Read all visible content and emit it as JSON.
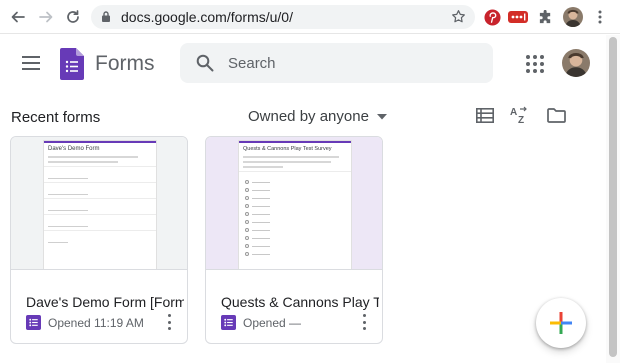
{
  "browser": {
    "url": "docs.google.com/forms/u/0/",
    "icons": [
      "back-arrow-icon",
      "forward-arrow-icon",
      "reload-icon",
      "lock-icon",
      "bookmark-star-icon",
      "pinterest-icon",
      "lastpass-icon",
      "extensions-puzzle-icon",
      "profile-avatar",
      "more-vert-icon"
    ]
  },
  "header": {
    "app_name": "Forms",
    "search_placeholder": "Search",
    "brand_color": "#673ab7"
  },
  "toolbar": {
    "section_title": "Recent forms",
    "owner_filter": "Owned by anyone",
    "view_buttons": [
      "list-view-icon",
      "sort-az-icon",
      "folder-icon"
    ]
  },
  "forms": [
    {
      "name": "Dave's Demo Form [Form]",
      "opened": "Opened 11:19 AM",
      "thumbnail_title": "Dave's Demo Form"
    },
    {
      "name": "Quests & Cannons Play Te...",
      "opened": "Opened —",
      "thumbnail_title": "Quests & Cannons Play Test Survey"
    }
  ]
}
